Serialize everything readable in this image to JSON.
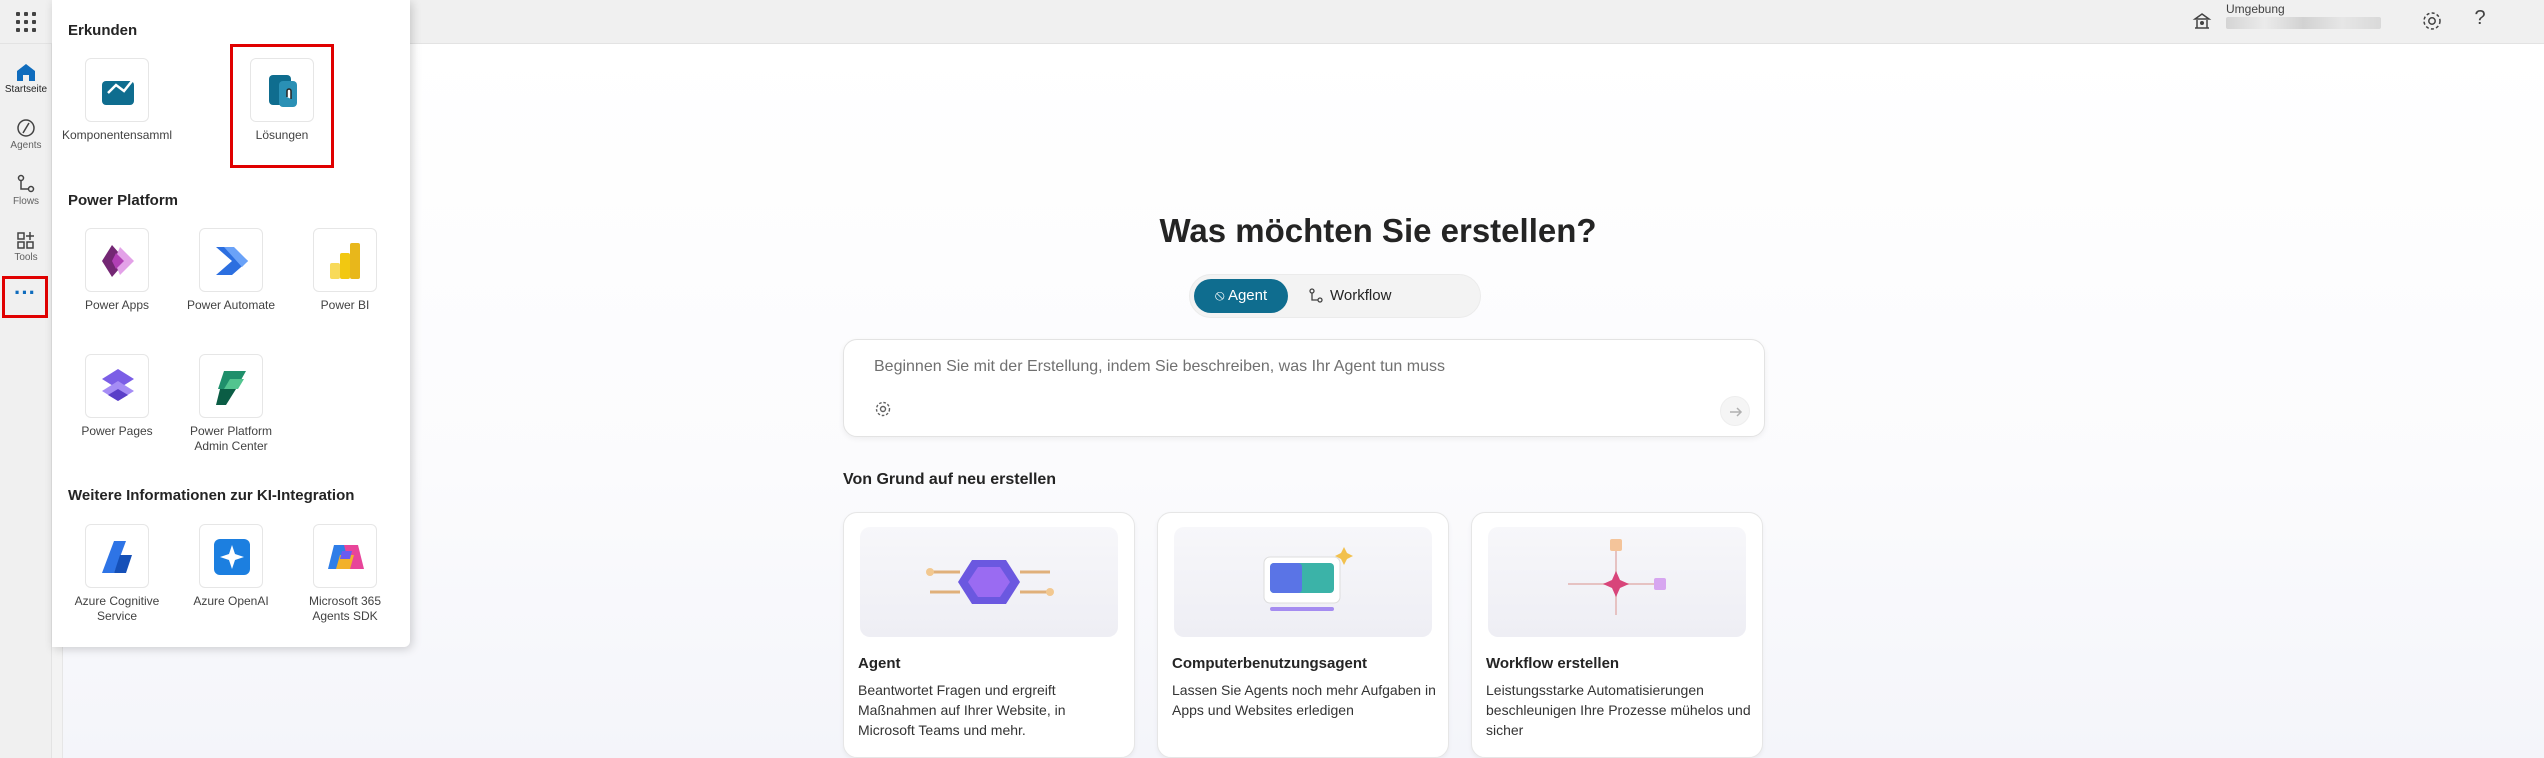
{
  "topbar": {
    "environment_label": "Umgebung",
    "help_glyph": "?"
  },
  "rail": {
    "items": [
      {
        "label": "Startseite",
        "icon": "home-icon"
      },
      {
        "label": "Agents",
        "icon": "agent-icon"
      },
      {
        "label": "Flows",
        "icon": "flow-icon"
      },
      {
        "label": "Tools",
        "icon": "tools-icon"
      }
    ],
    "more_glyph": "···"
  },
  "flyout": {
    "sections": [
      {
        "title": "Erkunden",
        "tiles": [
          "Komponentensamml",
          "Lösungen"
        ]
      },
      {
        "title": "Power Platform",
        "tiles": [
          "Power Apps",
          "Power Automate",
          "Power BI",
          "Power Pages",
          "Power Platform Admin Center"
        ]
      },
      {
        "title": "Weitere Informationen zur KI-Integration",
        "tiles": [
          "Azure Cognitive Service",
          "Azure OpenAI",
          "Microsoft 365 Agents SDK"
        ]
      }
    ]
  },
  "main": {
    "headline": "Was möchten Sie erstellen?",
    "toggle": {
      "agent": "Agent",
      "workflow": "Workflow"
    },
    "prompt": {
      "placeholder": "Beginnen Sie mit der Erstellung, indem Sie beschreiben, was Ihr Agent tun muss"
    },
    "section_title": "Von Grund auf neu erstellen",
    "cards": [
      {
        "title": "Agent",
        "desc": "Beantwortet Fragen und ergreift Maßnahmen auf Ihrer Website, in Microsoft Teams und mehr."
      },
      {
        "title": "Computerbenutzungsagent",
        "desc": "Lassen Sie Agents noch mehr Aufgaben in Apps und Websites erledigen"
      },
      {
        "title": "Workflow erstellen",
        "desc": "Leistungsstarke Automatisierungen beschleunigen Ihre Prozesse mühelos und sicher"
      }
    ]
  },
  "colors": {
    "accent": "#0f6d8f",
    "highlight": "#e00000",
    "link_blue": "#0f6cbd"
  }
}
